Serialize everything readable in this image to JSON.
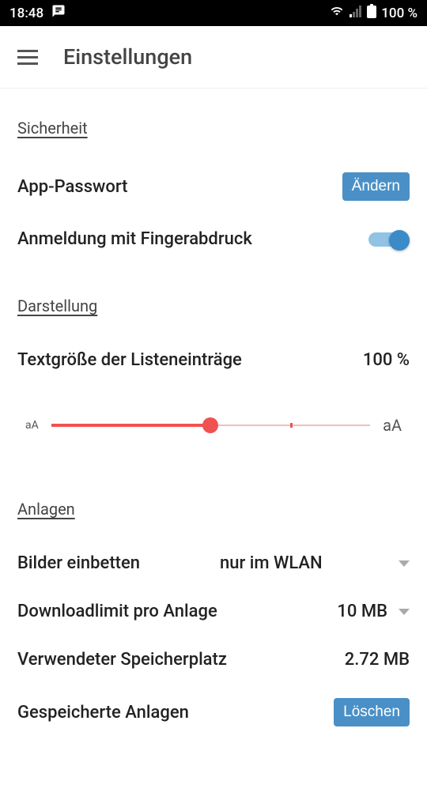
{
  "status_bar": {
    "time": "18:48",
    "battery": "100 %"
  },
  "app_bar": {
    "title": "Einstellungen"
  },
  "sections": {
    "security": {
      "heading": "Sicherheit",
      "app_password_label": "App-Passwort",
      "change_button": "Ändern",
      "fingerprint_label": "Anmeldung mit Fingerabdruck",
      "fingerprint_enabled": true
    },
    "display": {
      "heading": "Darstellung",
      "text_size_label": "Textgröße der Listeneinträge",
      "text_size_value": "100 %",
      "slider_min_label": "aA",
      "slider_max_label": "aA",
      "slider_percent": 50
    },
    "attachments": {
      "heading": "Anlagen",
      "embed_images_label": "Bilder einbetten",
      "embed_images_value": "nur im WLAN",
      "download_limit_label": "Downloadlimit pro Anlage",
      "download_limit_value": "10 MB",
      "used_storage_label": "Verwendeter Speicherplatz",
      "used_storage_value": "2.72 MB",
      "saved_attachments_label": "Gespeicherte Anlagen",
      "delete_button": "Löschen"
    }
  }
}
